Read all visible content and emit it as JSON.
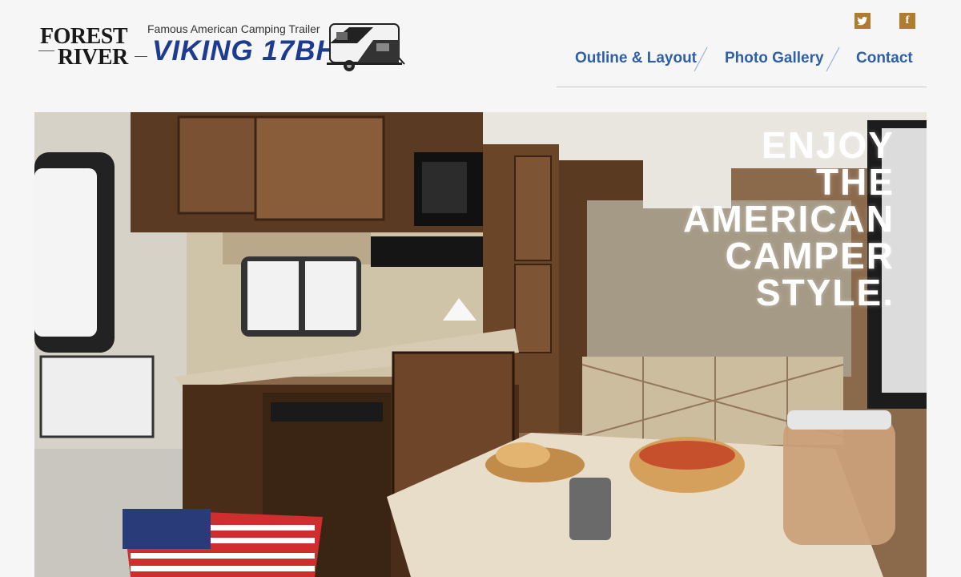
{
  "brand": {
    "logo_line1": "FOREST",
    "logo_line2": "RIVER",
    "tagline": "Famous American Camping Trailer",
    "model": "VIKING 17BH"
  },
  "social": {
    "twitter_icon": "twitter-icon",
    "facebook_icon": "facebook-icon",
    "facebook_glyph": "f",
    "accent_color": "#b07c2f"
  },
  "nav": {
    "items": [
      {
        "label": "Outline & Layout"
      },
      {
        "label": "Photo Gallery"
      },
      {
        "label": "Contact"
      }
    ],
    "color": "#2f5fa4"
  },
  "hero": {
    "headline_lines": [
      "ENJOY",
      "THE",
      "AMERICAN",
      "CAMPER",
      "STYLE."
    ]
  }
}
